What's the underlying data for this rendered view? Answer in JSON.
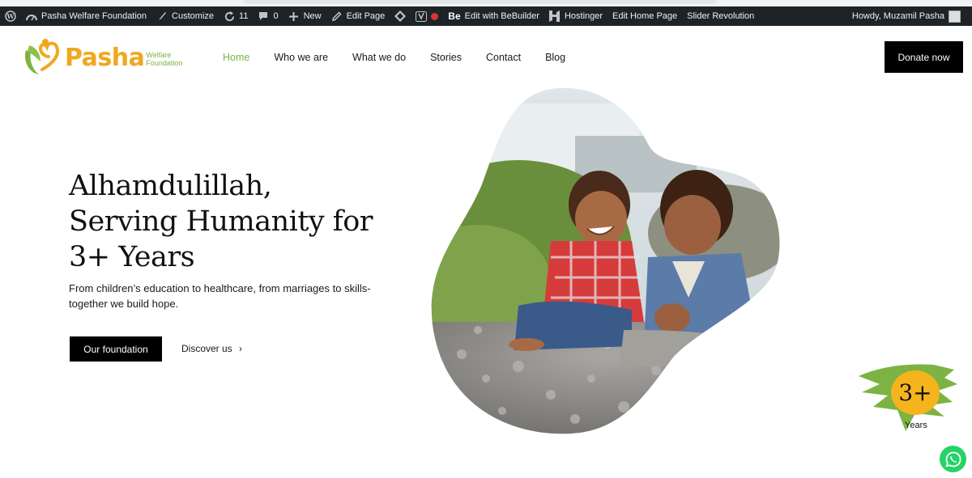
{
  "adminbar": {
    "site_name": "Pasha Welfare Foundation",
    "customize": "Customize",
    "updates_count": "11",
    "comments_count": "0",
    "new": "New",
    "edit_page": "Edit Page",
    "bebuilder": "Edit with BeBuilder",
    "bebuilder_logo": "Be",
    "hostinger": "Hostinger",
    "edit_home": "Edit Home Page",
    "slider": "Slider Revolution",
    "howdy": "Howdy, Muzamil Pasha"
  },
  "logo": {
    "name": "Pasha",
    "sub_line1": "Welfare",
    "sub_line2": "Foundation"
  },
  "nav": [
    "Home",
    "Who we are",
    "What we do",
    "Stories",
    "Contact",
    "Blog"
  ],
  "donate_label": "Donate now",
  "hero": {
    "title_line1": "Alhamdulillah,",
    "title_line2": "Serving Humanity for",
    "title_line3": "3+ Years",
    "description": "From children’s education to healthcare, from marriages to skills-together we build hope.",
    "primary_button": "Our foundation",
    "secondary_link": "Discover us",
    "secondary_link_arrow": "›"
  },
  "badge": {
    "number": "3+",
    "label": "Years"
  },
  "colors": {
    "brand_orange": "#f0a81c",
    "brand_green": "#7cb342",
    "badge_yellow": "#f5b41e",
    "whatsapp": "#25d366"
  }
}
